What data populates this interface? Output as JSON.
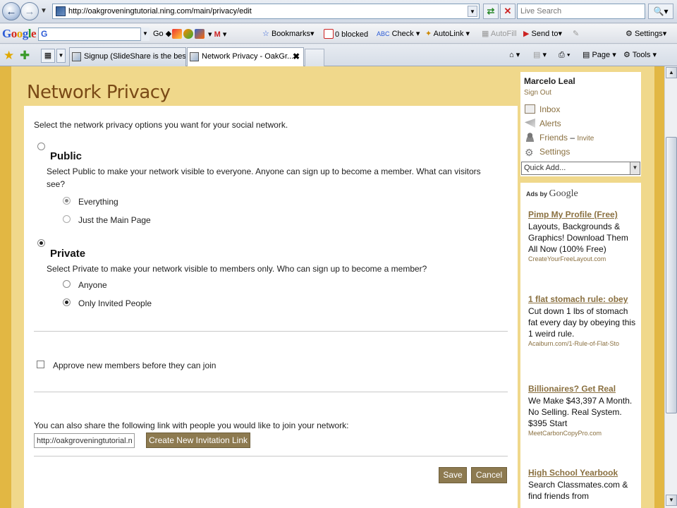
{
  "browser": {
    "url": "http://oakgroveningtutorial.ning.com/main/privacy/edit",
    "search_placeholder": "Live Search",
    "google_toolbar": {
      "logo": [
        "G",
        "o",
        "o",
        "g",
        "l",
        "e"
      ],
      "search_value": "G",
      "go": "Go",
      "bookmarks": "Bookmarks",
      "blocked": "0 blocked",
      "check": "Check",
      "autolink": "AutoLink",
      "autofill": "AutoFill",
      "send_to": "Send to",
      "settings": "Settings"
    },
    "tabs": [
      {
        "label": "Signup (SlideShare is the bes...",
        "active": false
      },
      {
        "label": "Network Privacy - OakGr...",
        "active": true
      }
    ],
    "tab_tools": {
      "page": "Page",
      "tools": "Tools"
    }
  },
  "page": {
    "title": "Network Privacy",
    "intro": "Select the network privacy options you want for your social network.",
    "public": {
      "title": "Public",
      "desc": "Select Public to make your network visible to everyone. Anyone can sign up to become a member. What can visitors see?",
      "options": [
        {
          "label": "Everything",
          "checked": true
        },
        {
          "label": "Just the Main Page",
          "checked": false
        }
      ],
      "selected": false
    },
    "private": {
      "title": "Private",
      "desc": "Select Private to make your network visible to members only. Who can sign up to become a member?",
      "options": [
        {
          "label": "Anyone",
          "checked": false
        },
        {
          "label": "Only Invited People",
          "checked": true
        }
      ],
      "selected": true
    },
    "approve_label": "Approve new members before they can join",
    "share_text": "You can also share the following link with people you would like to join your network:",
    "share_link": "http://oakgroveningtutorial.ning.com/",
    "create_invite_btn": "Create New Invitation Link",
    "save_btn": "Save",
    "cancel_btn": "Cancel"
  },
  "sidebar": {
    "user_name": "Marcelo Leal",
    "sign_out": "Sign Out",
    "links": [
      {
        "label": "Inbox",
        "icon": "inbox-icon"
      },
      {
        "label": "Alerts",
        "icon": "alerts-icon"
      },
      {
        "label": "Friends",
        "icon": "friends-icon",
        "extra": "Invite"
      },
      {
        "label": "Settings",
        "icon": "settings-icon"
      }
    ],
    "quick_add": "Quick Add..."
  },
  "ads": {
    "ads_by": "Ads by",
    "google": "Google",
    "items": [
      {
        "title": "Pimp My Profile (Free)",
        "body": "Layouts, Backgrounds & Graphics! Download Them All Now (100% Free)",
        "url": "CreateYourFreeLayout.com"
      },
      {
        "title": "1 flat stomach rule: obey",
        "body": "Cut down 1 lbs of stomach fat every day by obeying this 1 weird rule.",
        "url": "Acaiburn.com/1-Rule-of-Flat-Sto"
      },
      {
        "title": "Billionaires? Get Real",
        "body": "We Make $43,397 A Month. No Selling. Real System. $395 Start",
        "url": "MeetCarbonCopyPro.com"
      },
      {
        "title": "High School Yearbook",
        "body": "Search Classmates.com & find friends from",
        "url": ""
      }
    ]
  },
  "colors": {
    "page_bg": "#e2b743",
    "content_bg": "#f0d88b",
    "title": "#7a4a16",
    "link": "#8a7040",
    "button": "#8d7a50"
  }
}
